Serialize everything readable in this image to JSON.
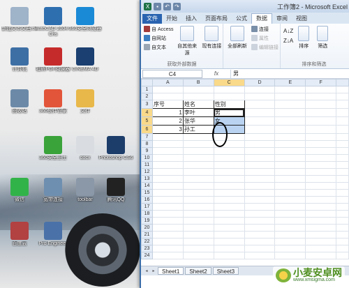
{
  "desktop": {
    "icons": [
      {
        "label": "新建文本文档.txt",
        "icon": "text-file-icon",
        "color": "#9fb3c9"
      },
      {
        "label": "AutoCAD 2004 - Chs",
        "icon": "autocad-icon",
        "color": "#2e6fb0"
      },
      {
        "label": "360安全浏览器",
        "icon": "ie-icon",
        "color": "#1b8ad6"
      },
      {
        "label": "计算机",
        "icon": "computer-icon",
        "color": "#3d6fa5"
      },
      {
        "label": "福昕PDF阅读器",
        "icon": "pdf-icon",
        "color": "#c62b2b"
      },
      {
        "label": "CINEMA 4D",
        "icon": "cinema4d-icon",
        "color": "#1a3f70"
      },
      {
        "label": "回收站",
        "icon": "recycle-bin-icon",
        "color": "#6c8aa8"
      },
      {
        "label": "360软件管家",
        "icon": "store-icon",
        "color": "#e2553a"
      },
      {
        "label": "文件",
        "icon": "folder-icon",
        "color": "#e8b84a"
      },
      {
        "label": "360安全卫士",
        "icon": "shield-icon",
        "color": "#3aa33a"
      },
      {
        "label": "docx",
        "icon": "document-icon",
        "color": "#d9dde2"
      },
      {
        "label": "Photoshop CS6",
        "icon": "photoshop-icon",
        "color": "#1c3d69"
      },
      {
        "label": "微信",
        "icon": "wechat-icon",
        "color": "#32b34a"
      },
      {
        "label": "宽带连接",
        "icon": "network-icon",
        "color": "#6f8fb0"
      },
      {
        "label": "toolbar",
        "icon": "toolbar-icon",
        "color": "#8a98a8"
      },
      {
        "label": "腾讯QQ",
        "icon": "qq-icon",
        "color": "#222222"
      },
      {
        "label": "百度云",
        "icon": "app-icon",
        "color": "#b24141"
      },
      {
        "label": "Pro Engineer",
        "icon": "engineer-icon",
        "color": "#4a72a8"
      }
    ]
  },
  "excel": {
    "title": "工作簿2 - Microsoft Excel",
    "tabs": [
      "文件",
      "开始",
      "插入",
      "页面布局",
      "公式",
      "数据",
      "审阅",
      "视图"
    ],
    "active_tab": "数据",
    "ribbon": {
      "from_access": "自 Access",
      "from_web": "自网站",
      "from_text": "自文本",
      "from_other": "自其他来源",
      "existing_conn": "现有连接",
      "group_external": "获取外部数据",
      "refresh_all": "全部刷新",
      "connections": "连接",
      "properties": "属性",
      "edit_links": "编辑链接",
      "sort": "排序",
      "filter": "筛选",
      "group_sort": "排序和筛选"
    },
    "name_box": "C4",
    "fx_label": "fx",
    "formula_value": "男",
    "columns": [
      "A",
      "B",
      "C",
      "D",
      "E",
      "F"
    ],
    "rows": [
      "1",
      "2",
      "3",
      "4",
      "5",
      "6",
      "7",
      "8",
      "9",
      "10",
      "11",
      "12",
      "13",
      "14",
      "15",
      "16",
      "17",
      "18",
      "19",
      "20",
      "21",
      "22",
      "23",
      "24"
    ],
    "table": {
      "headers": [
        "序号",
        "姓名",
        "性别"
      ],
      "records": [
        {
          "no": "1",
          "name": "李叶",
          "gender": "男"
        },
        {
          "no": "2",
          "name": "张华",
          "gender": "女"
        },
        {
          "no": "3",
          "name": "孙工",
          "gender": ""
        }
      ]
    },
    "sheets": [
      "Sheet1",
      "Sheet2",
      "Sheet3"
    ]
  },
  "watermark": {
    "name": "小麦安卓网",
    "url": "www.xmsigma.com"
  }
}
